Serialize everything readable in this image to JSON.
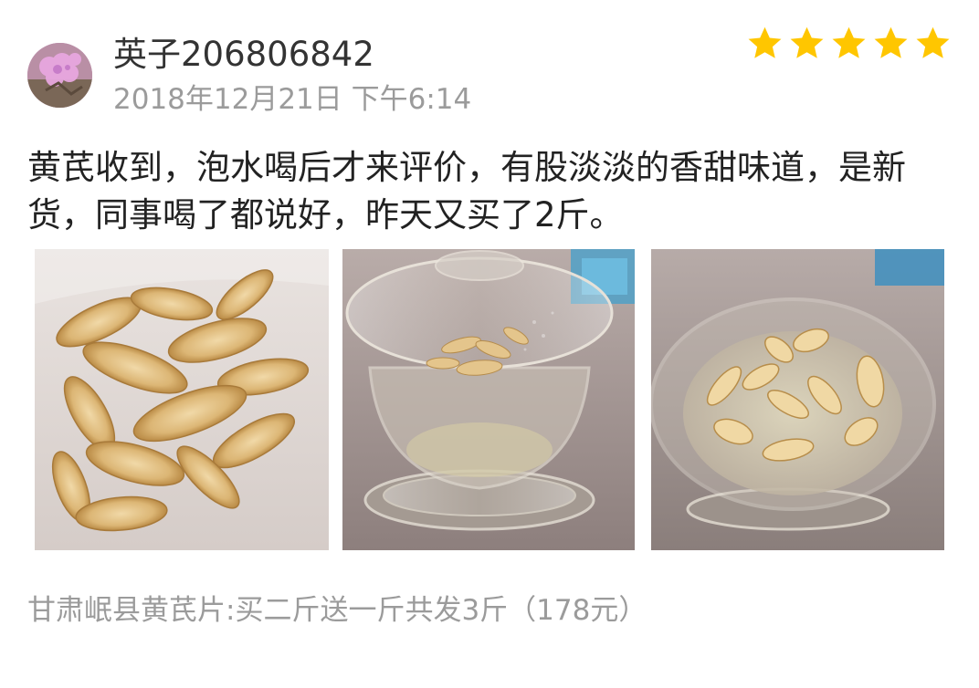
{
  "user": {
    "name": "英子206806842",
    "timestamp": "2018年12月21日 下午6:14",
    "avatar_icon": "pink-flower-avatar"
  },
  "rating": {
    "stars": 5,
    "max": 5,
    "color": "#FFC600"
  },
  "review": {
    "text": "黄芪收到，泡水喝后才来评价，有股淡淡的香甜味道，是新货，同事喝了都说好，昨天又买了2斤。"
  },
  "photos": [
    {
      "subject": "dried-astragalus-slices"
    },
    {
      "subject": "glass-gaiwan-with-astragalus-tea"
    },
    {
      "subject": "glass-bowl-soaking-astragalus"
    }
  ],
  "product": {
    "name": "甘肃岷县黄芪片:买二斤送一斤共发3斤（178元）"
  }
}
